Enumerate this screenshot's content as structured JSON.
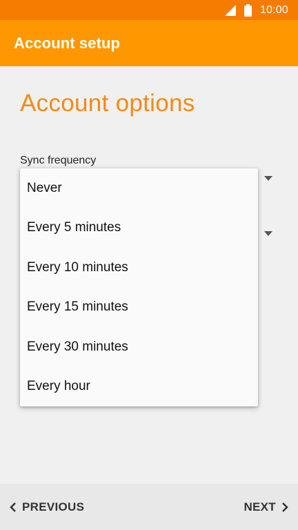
{
  "status_bar": {
    "time": "10:00",
    "icons": [
      "signal-icon",
      "battery-icon"
    ]
  },
  "app_bar": {
    "title": "Account setup"
  },
  "page": {
    "title": "Account options",
    "field_label": "Sync frequency"
  },
  "dropdown": {
    "options": [
      "Never",
      "Every 5 minutes",
      "Every 10 minutes",
      "Every 15 minutes",
      "Every 30 minutes",
      "Every hour"
    ]
  },
  "footer": {
    "previous_label": "PREVIOUS",
    "next_label": "NEXT"
  },
  "colors": {
    "status_bar": "#f57c00",
    "app_bar": "#ff9800",
    "accent_text": "#f58a12"
  }
}
